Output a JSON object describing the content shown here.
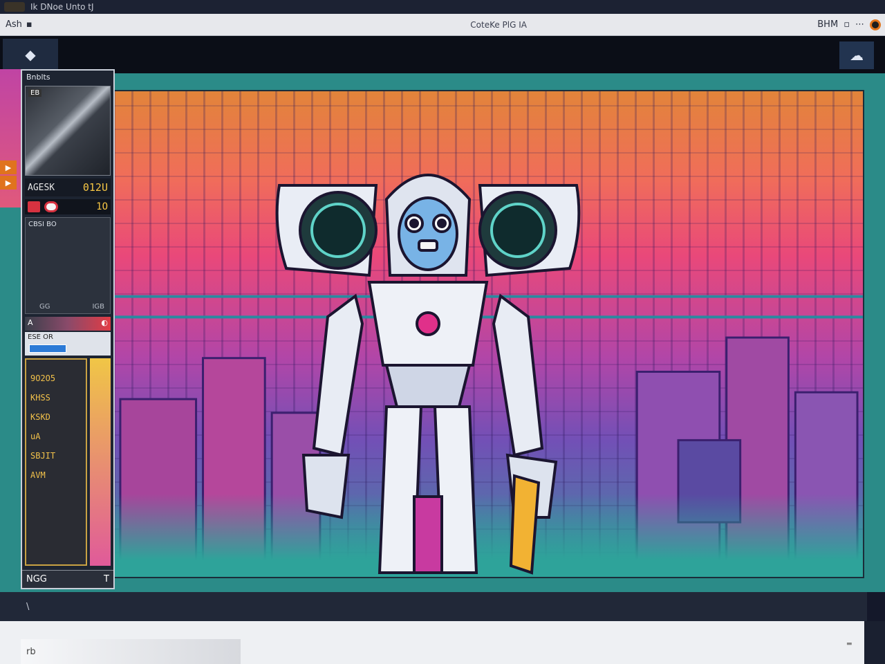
{
  "window": {
    "title": "Ik DNoe Unto tJ",
    "doc_title": "CoteKe PlG IA"
  },
  "menubar": {
    "left_label": "Ash",
    "right_label": "BHM",
    "indicator_color": "#e2751c"
  },
  "toolbar": {
    "left_tool": "pointer-tool",
    "right_tool": "cloud-tool"
  },
  "side_panel": {
    "header": "Bnblts",
    "preview_badge": "EB",
    "readout_label": "AGESK",
    "readout_value": "012U",
    "status_value": "1O",
    "list_title": "CBSI BO",
    "list_foot_left": "GG",
    "list_foot_right": "IGB",
    "colorbar_label": "A",
    "field_label": "ESE OR",
    "layers": [
      "9O2O5",
      "KHSS",
      "KSKD",
      "uA",
      "SBJIT",
      "AVM"
    ],
    "footer_left": "NGG",
    "footer_right": "T"
  },
  "status_bar": {
    "text": "\\"
  },
  "bottom": {
    "input_value": "rb"
  },
  "colors": {
    "canvas_border": "#1b2d3a",
    "workspace": "#2b8b88",
    "accent_orange": "#e0731e",
    "accent_yellow": "#f6c644",
    "accent_red": "#d63240"
  }
}
